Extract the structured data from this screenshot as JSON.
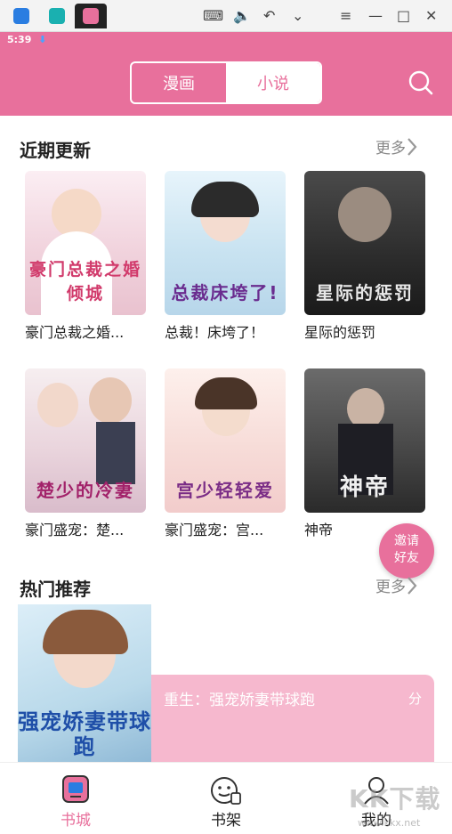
{
  "emulator": {
    "tabs": [
      {
        "name": "home"
      },
      {
        "name": "app-store"
      },
      {
        "name": "comic-app"
      }
    ],
    "controls": [
      "keyboard-icon",
      "volume-icon",
      "back-icon",
      "chevron-down-icon",
      "menu-icon",
      "minimize-icon",
      "maximize-icon",
      "close-icon"
    ]
  },
  "statusbar": {
    "time": "5:39",
    "indicator": "download-icon"
  },
  "header": {
    "segment": {
      "comic": "漫画",
      "novel": "小说",
      "selected": "小说"
    },
    "search_icon": "search-icon"
  },
  "recent": {
    "title": "近期更新",
    "more": "更多",
    "books": [
      {
        "label": "豪门总裁之婚...",
        "cover_text": "豪门总裁之婚倾城",
        "theme": "light-pink"
      },
      {
        "label": "总裁！床垮了！",
        "cover_text": "总裁床垮了!",
        "theme": "light-blue"
      },
      {
        "label": "星际的惩罚",
        "cover_text": "星际的惩罚",
        "theme": "dark"
      },
      {
        "label": "豪门盛宠：楚...",
        "cover_text": "楚少的冷妻",
        "theme": "light-pink"
      },
      {
        "label": "豪门盛宠：宫...",
        "cover_text": "宫少轻轻爱",
        "theme": "soft-peach"
      },
      {
        "label": "神帝",
        "cover_text": "神帝",
        "theme": "dark-gray"
      }
    ]
  },
  "invite": {
    "line1": "邀请",
    "line2": "好友"
  },
  "hot": {
    "title": "热门推荐",
    "more": "更多",
    "book": {
      "cover_text": "强宠娇妻带球跑",
      "title": "重生：强宠娇妻带球跑",
      "score": "分"
    }
  },
  "tabbar": {
    "items": [
      {
        "label": "书城",
        "icon": "bookstore-icon",
        "active": true
      },
      {
        "label": "书架",
        "icon": "bookshelf-icon",
        "active": false
      },
      {
        "label": "我的",
        "icon": "profile-icon",
        "active": false
      }
    ]
  },
  "watermark": {
    "text": "KK下载",
    "url": "www.kkx.net"
  },
  "colors": {
    "accent": "#e8709c",
    "muted": "#888888",
    "card_pink": "#f6b8ce"
  }
}
